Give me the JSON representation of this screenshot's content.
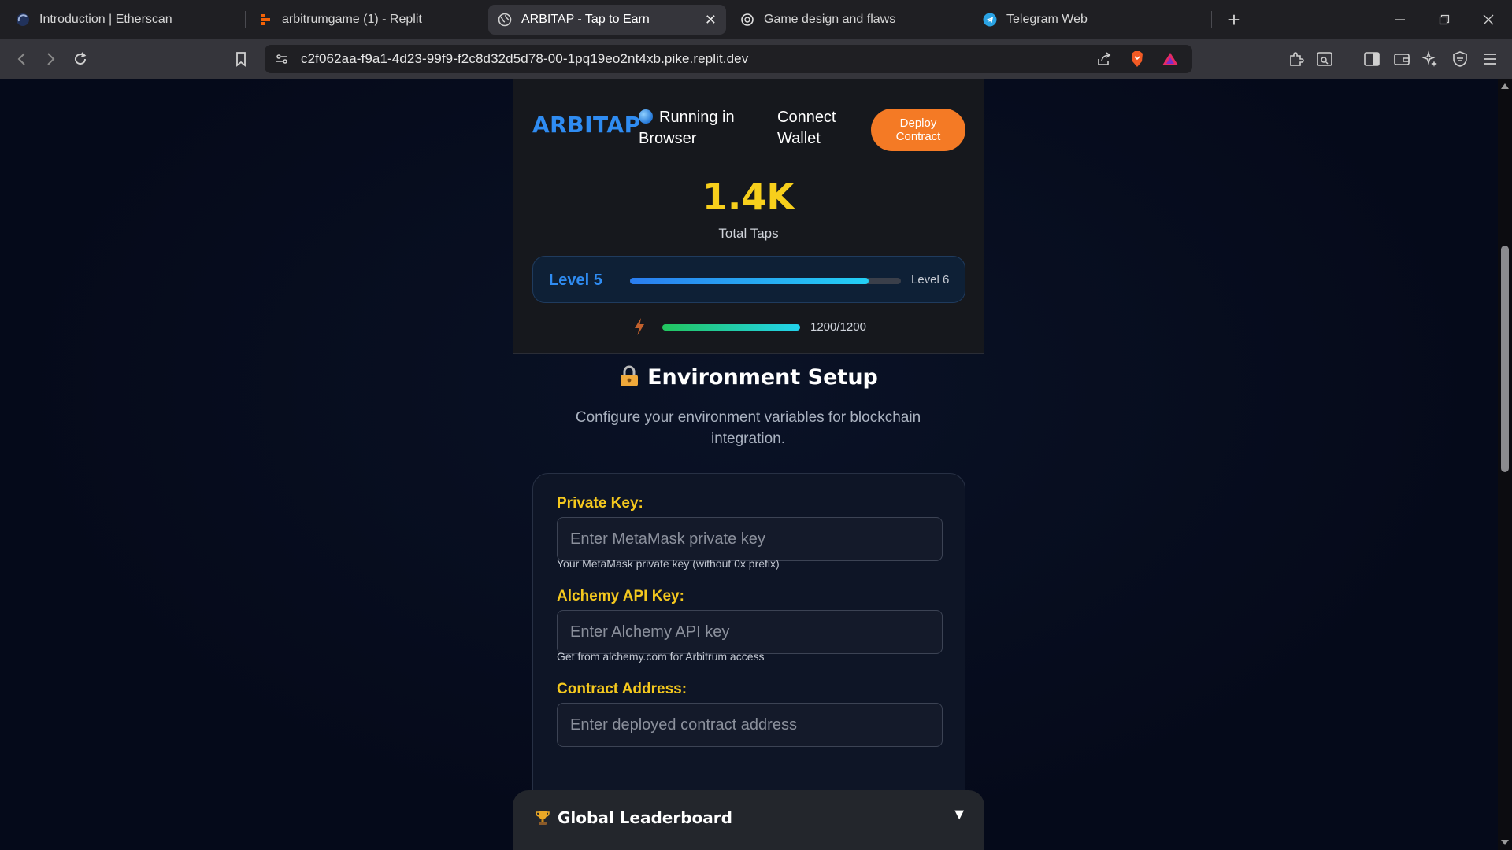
{
  "browser": {
    "tabs": [
      {
        "title": "Introduction | Etherscan",
        "icon": "etherscan-icon"
      },
      {
        "title": "arbitrumgame (1) - Replit",
        "icon": "replit-icon"
      },
      {
        "title": "ARBITAP - Tap to Earn",
        "icon": "globe-icon",
        "active": true
      },
      {
        "title": "Game design and flaws",
        "icon": "chatgpt-icon"
      },
      {
        "title": "Telegram Web",
        "icon": "telegram-icon"
      }
    ],
    "url": "c2f062aa-f9a1-4d23-99f9-f2c8d32d5d78-00-1pq19eo2nt4xb.pike.replit.dev",
    "new_tab_label": "+",
    "close_label": "✕"
  },
  "header": {
    "logo": "ARBITAP",
    "status": "Running in Browser",
    "connect": "Connect Wallet",
    "deploy": "Deploy Contract"
  },
  "stats": {
    "taps": "1.4K",
    "taps_label": "Total Taps",
    "level_current": "Level 5",
    "level_next": "Level 6",
    "level_progress": 0.88,
    "energy_text": "1200/1200",
    "energy_progress": 1.0
  },
  "env": {
    "title": "Environment Setup",
    "description": "Configure your environment variables for blockchain integration.",
    "fields": [
      {
        "label": "Private Key:",
        "placeholder": "Enter MetaMask private key",
        "help": "Your MetaMask private key (without 0x prefix)"
      },
      {
        "label": "Alchemy API Key:",
        "placeholder": "Enter Alchemy API key",
        "help": "Get from alchemy.com for Arbitrum access"
      },
      {
        "label": "Contract Address:",
        "placeholder": "Enter deployed contract address",
        "help": ""
      }
    ]
  },
  "leaderboard": {
    "title": "Global Leaderboard",
    "toggle": "▼"
  },
  "colors": {
    "accent_blue": "#2f8cf2",
    "gold": "#f7cf1c",
    "orange": "#f47a25"
  }
}
